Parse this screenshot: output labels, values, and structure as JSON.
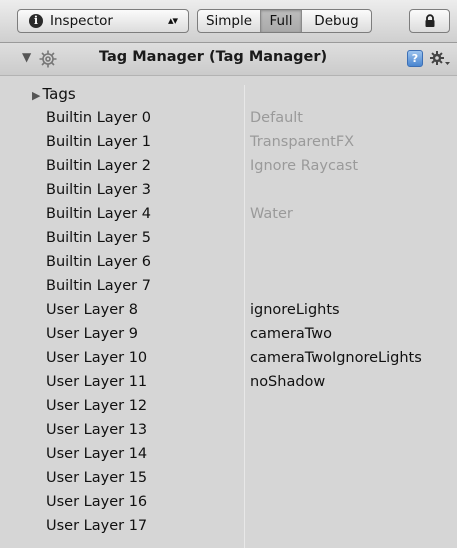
{
  "toolbar": {
    "inspector_label": "Inspector",
    "modes": [
      "Simple",
      "Full",
      "Debug"
    ],
    "active_mode": "Full"
  },
  "component": {
    "title": "Tag Manager (Tag Manager)"
  },
  "tags_label": "Tags",
  "layers": [
    {
      "name": "Builtin Layer 0",
      "value": "Default",
      "disabled": true
    },
    {
      "name": "Builtin Layer 1",
      "value": "TransparentFX",
      "disabled": true
    },
    {
      "name": "Builtin Layer 2",
      "value": "Ignore Raycast",
      "disabled": true
    },
    {
      "name": "Builtin Layer 3",
      "value": "",
      "disabled": true
    },
    {
      "name": "Builtin Layer 4",
      "value": "Water",
      "disabled": true
    },
    {
      "name": "Builtin Layer 5",
      "value": "",
      "disabled": true
    },
    {
      "name": "Builtin Layer 6",
      "value": "",
      "disabled": true
    },
    {
      "name": "Builtin Layer 7",
      "value": "",
      "disabled": true
    },
    {
      "name": "User Layer 8",
      "value": "ignoreLights",
      "disabled": false
    },
    {
      "name": "User Layer 9",
      "value": "cameraTwo",
      "disabled": false
    },
    {
      "name": "User Layer 10",
      "value": "cameraTwoIgnoreLights",
      "disabled": false
    },
    {
      "name": "User Layer 11",
      "value": "noShadow",
      "disabled": false
    },
    {
      "name": "User Layer 12",
      "value": "",
      "disabled": false
    },
    {
      "name": "User Layer 13",
      "value": "",
      "disabled": false
    },
    {
      "name": "User Layer 14",
      "value": "",
      "disabled": false
    },
    {
      "name": "User Layer 15",
      "value": "",
      "disabled": false
    },
    {
      "name": "User Layer 16",
      "value": "",
      "disabled": false
    },
    {
      "name": "User Layer 17",
      "value": "",
      "disabled": false
    }
  ]
}
